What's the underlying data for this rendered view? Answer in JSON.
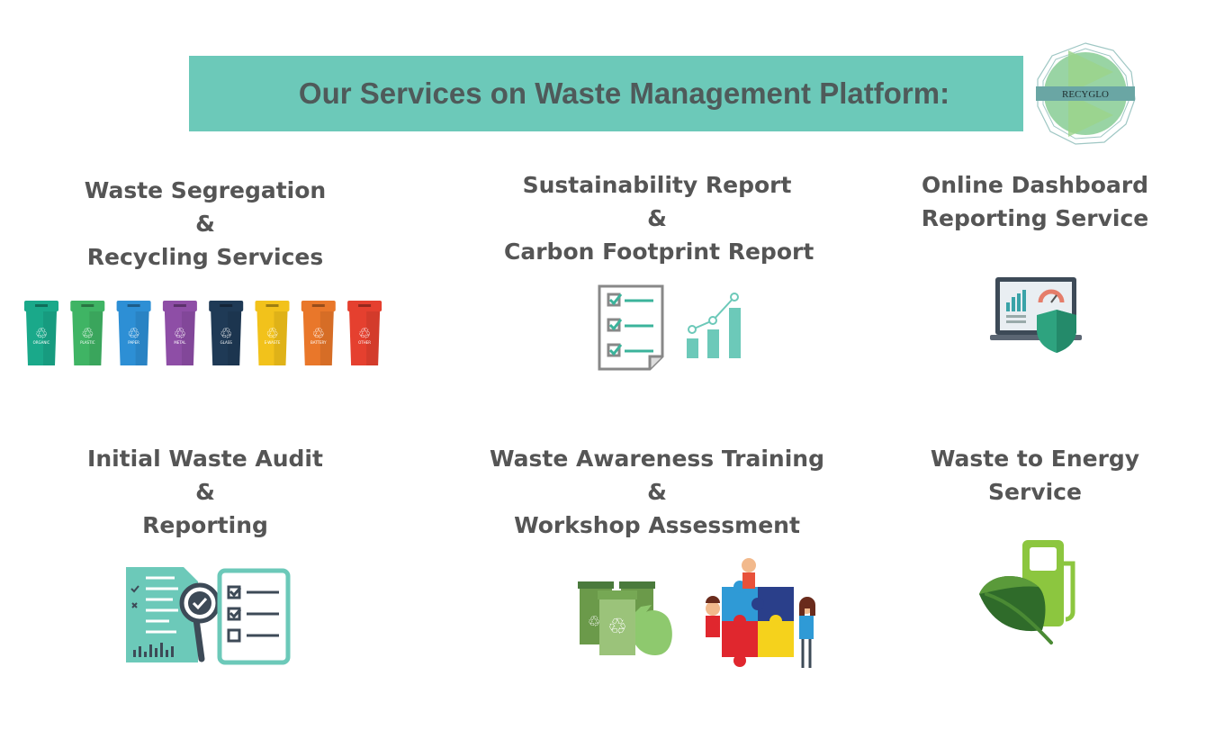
{
  "header": {
    "title": "Our Services on Waste Management Platform:",
    "logo_text": "RECYGLO"
  },
  "services": [
    {
      "lines": [
        "Waste Segregation",
        "&",
        "Recycling Services"
      ],
      "bin_labels": [
        "ORGANIC",
        "PLASTIC",
        "PAPER",
        "METAL",
        "GLASS",
        "E-WASTE",
        "BATTERY",
        "OTHER"
      ]
    },
    {
      "lines": [
        "Sustainability Report",
        "&",
        "Carbon Footprint Report"
      ]
    },
    {
      "lines": [
        "Online Dashboard",
        "Reporting Service"
      ]
    },
    {
      "lines": [
        "Initial Waste Audit",
        "&",
        "Reporting"
      ]
    },
    {
      "lines": [
        "Waste Awareness Training",
        "&",
        "Workshop Assessment"
      ]
    },
    {
      "lines": [
        "Waste to Energy",
        "Service"
      ]
    }
  ],
  "colors": {
    "banner": "#6cc9b9",
    "bins": [
      "#1aa98a",
      "#3fb464",
      "#2d8fd5",
      "#8e4ea6",
      "#1f3a56",
      "#f2c21b",
      "#e9772a",
      "#e5402f"
    ]
  }
}
